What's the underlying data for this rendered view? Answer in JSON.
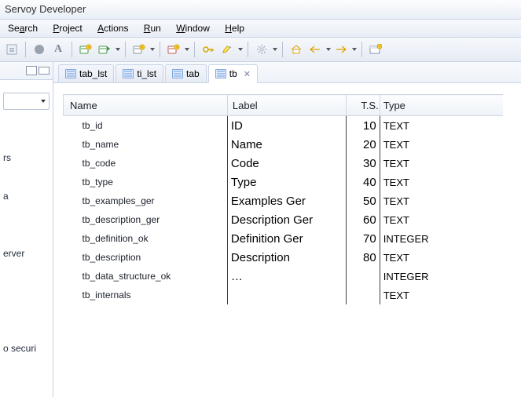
{
  "title": "Servoy Developer",
  "menu": [
    "Search",
    "Project",
    "Actions",
    "Run",
    "Window",
    "Help"
  ],
  "menu_mn": [
    "a",
    "P",
    "A",
    "R",
    "W",
    "H"
  ],
  "side": {
    "items": [
      "",
      "",
      "",
      "rs",
      "",
      "a",
      "",
      "",
      "erver",
      "",
      "",
      "",
      "",
      "o securi"
    ]
  },
  "tabs": [
    {
      "label": "tab_lst",
      "active": false,
      "closable": false
    },
    {
      "label": "ti_lst",
      "active": false,
      "closable": false
    },
    {
      "label": "tab",
      "active": false,
      "closable": false
    },
    {
      "label": "tb",
      "active": true,
      "closable": true
    }
  ],
  "columns": [
    "Name",
    "Label",
    "T.S.",
    "Type"
  ],
  "rows": [
    {
      "name": "tb_id",
      "label": "ID",
      "ts": "10",
      "type": "TEXT"
    },
    {
      "name": "tb_name",
      "label": "Name",
      "ts": "20",
      "type": "TEXT"
    },
    {
      "name": "tb_code",
      "label": "Code",
      "ts": "30",
      "type": "TEXT"
    },
    {
      "name": "tb_type",
      "label": "Type",
      "ts": "40",
      "type": "TEXT"
    },
    {
      "name": "tb_examples_ger",
      "label": "Examples Ger",
      "ts": "50",
      "type": "TEXT"
    },
    {
      "name": "tb_description_ger",
      "label": "Description Ger",
      "ts": "60",
      "type": "TEXT"
    },
    {
      "name": "tb_definition_ok",
      "label": "Definition Ger",
      "ts": "70",
      "type": "INTEGER"
    },
    {
      "name": "tb_description",
      "label": "Description",
      "ts": "80",
      "type": "TEXT"
    },
    {
      "name": "tb_data_structure_ok",
      "label": "…",
      "ts": "",
      "type": "INTEGER"
    },
    {
      "name": "tb_internals",
      "label": "",
      "ts": "",
      "type": "TEXT"
    }
  ]
}
